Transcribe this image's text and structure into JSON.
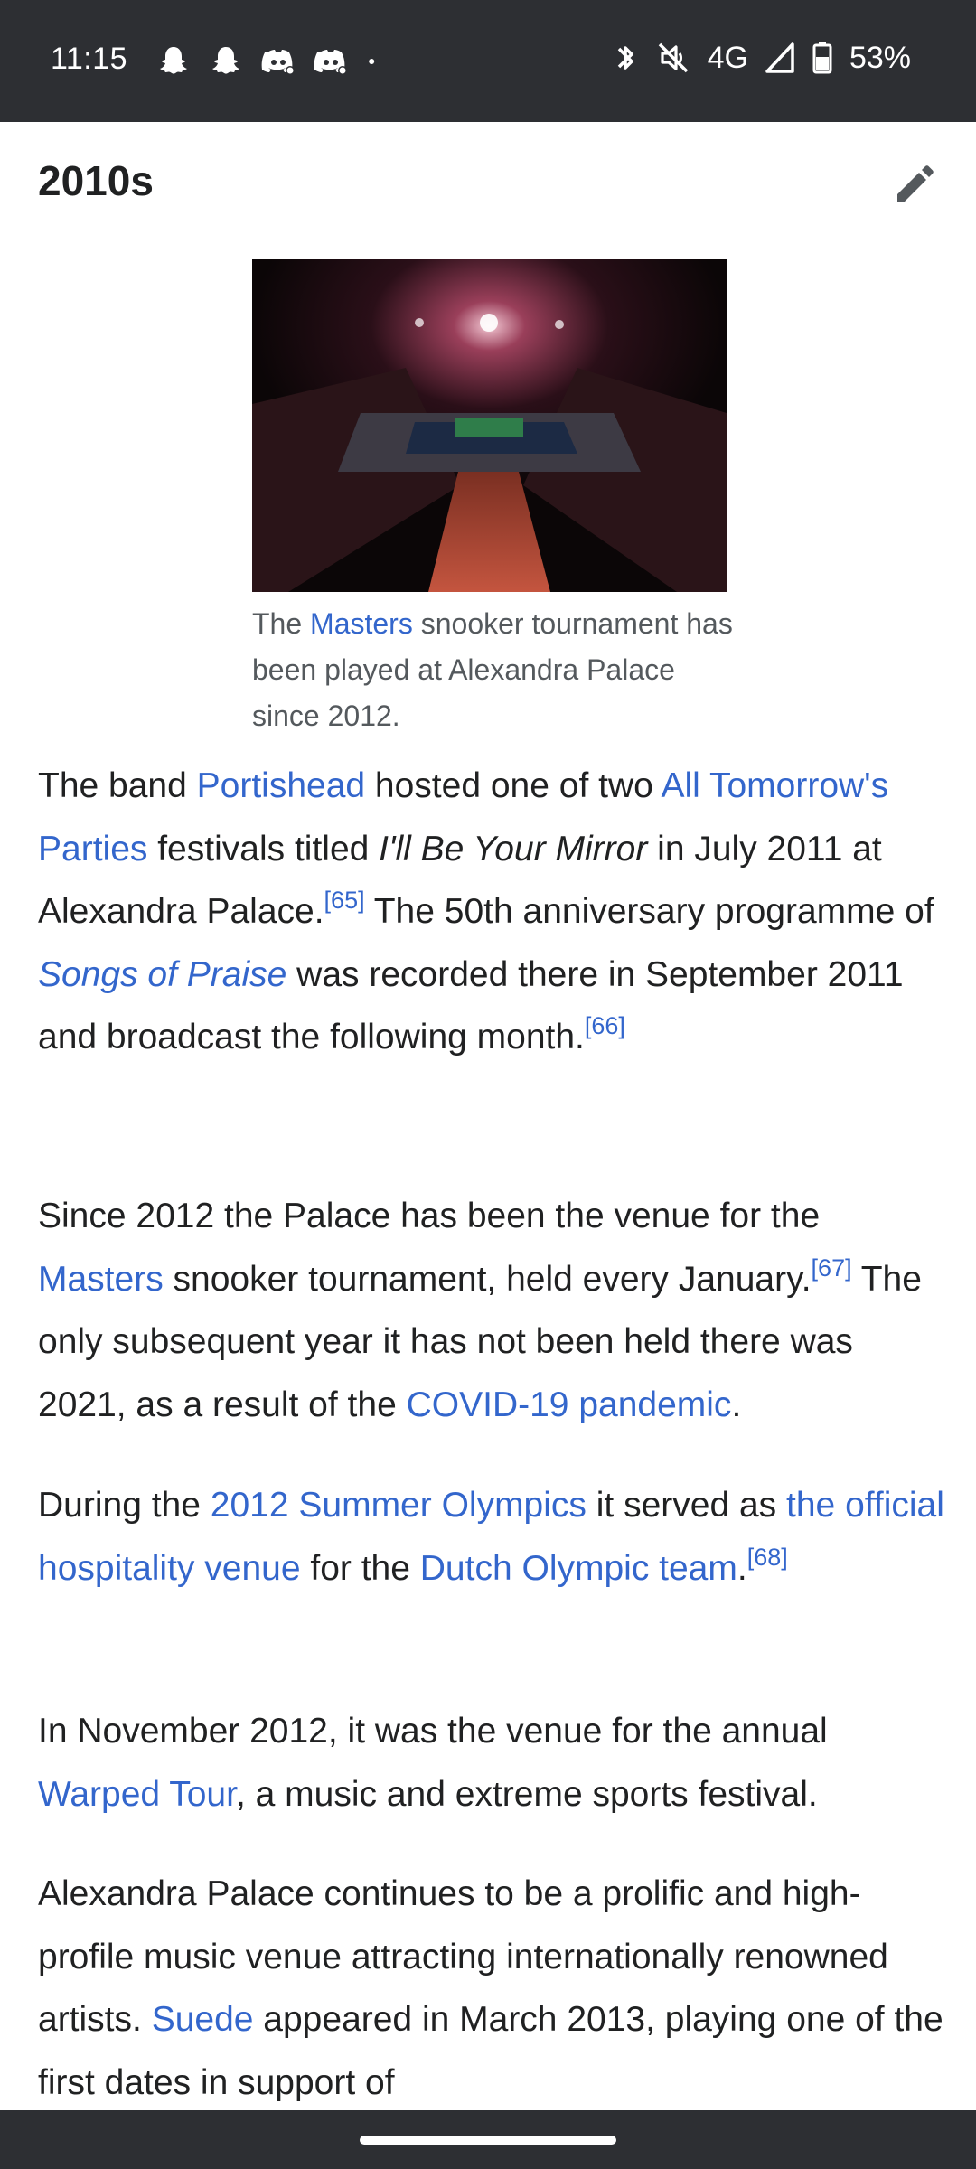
{
  "status_bar": {
    "time": "11:15",
    "network": "4G",
    "battery": "53%",
    "notification_icons": [
      "snapchat-icon",
      "snapchat-icon",
      "discord-icon",
      "discord-icon",
      "dot-icon"
    ],
    "system_icons": [
      "bluetooth-icon",
      "mute-icon",
      "signal-icon",
      "battery-icon"
    ]
  },
  "section": {
    "title": "2010s",
    "edit_icon": "pencil-icon"
  },
  "figure": {
    "caption_pre": "The ",
    "caption_link": "Masters",
    "caption_post": " snooker tournament has been played at Alexandra Palace since 2012."
  },
  "paragraphs": [
    {
      "t1": "The band ",
      "l1": "Portishead",
      "t2": " hosted one of two ",
      "l2": "All Tomorrow's Parties",
      "t3": " festivals titled ",
      "i1": "I'll Be Your Mirror",
      "t4": " in July 2011 at Alexandra Palace.",
      "r1": "[65]",
      "t5": " The 50th anniversary programme of ",
      "l3": "Songs of Praise",
      "t6": " was recorded there in September 2011 and broadcast the following month.",
      "r2": "[66]"
    },
    {
      "t1": "Since 2012 the Palace has been the venue for the ",
      "l1": "Masters",
      "t2": " snooker tournament, held every January.",
      "r1": "[67]",
      "t3": " The only subsequent year it has not been held there was 2021, as a result of the ",
      "l2": "COVID-19 pandemic",
      "t4": "."
    },
    {
      "t1": "During the ",
      "l1": "2012 Summer Olympics",
      "t2": " it served as ",
      "l2": "the official hospitality venue",
      "t3": " for the ",
      "l3": "Dutch Olympic team",
      "t4": ".",
      "r1": "[68]"
    },
    {
      "t1": "In November 2012, it was the venue for the annual ",
      "l1": "Warped Tour",
      "t2": ", a music and extreme sports festival."
    },
    {
      "t1": "Alexandra Palace continues to be a prolific and high-profile music venue attracting internationally renowned artists. ",
      "l1": "Suede",
      "t2": " appeared in March 2013, playing one of the first dates in support of"
    }
  ],
  "colors": {
    "link": "#3366cc",
    "text": "#202122",
    "caption": "#54595d",
    "system_bar": "#2d2f33"
  }
}
